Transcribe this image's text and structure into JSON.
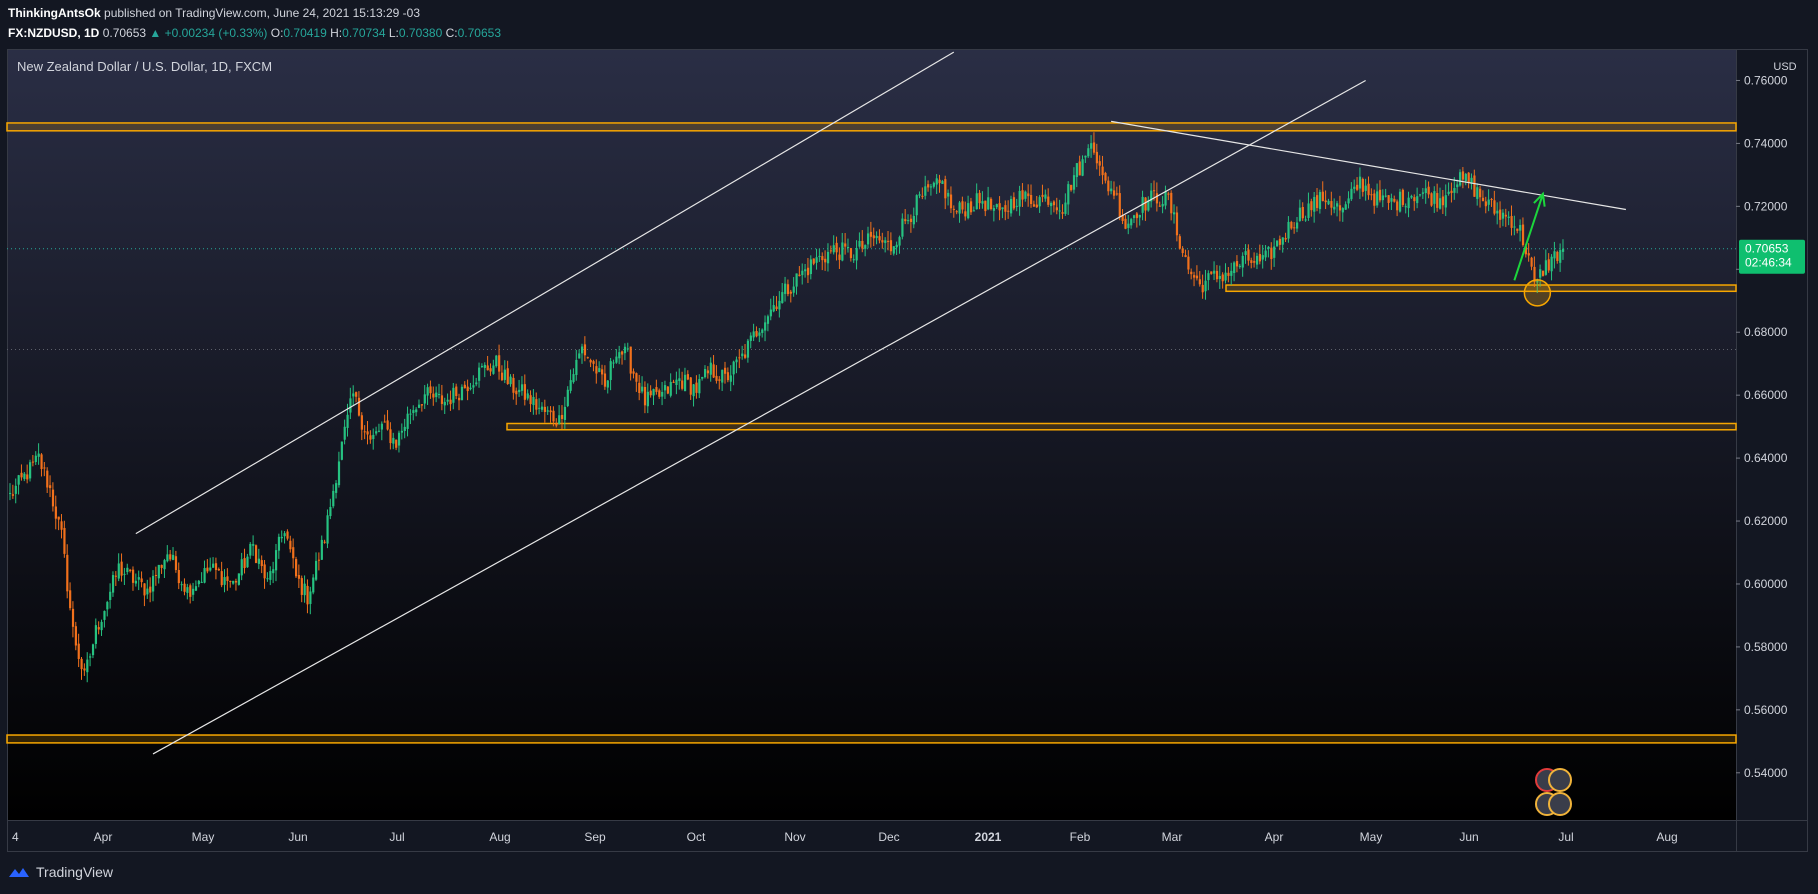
{
  "header": {
    "author": "ThinkingAntsOk",
    "published_text": "published on TradingView.com, June 24, 2021 15:13:29 -03",
    "symbol": "FX:NZDUSD, 1D",
    "last": "0.70653",
    "change": "▲ +0.00234 (+0.33%)",
    "o_label": "O:",
    "o": "0.70419",
    "h_label": "H:",
    "h": "0.70734",
    "l_label": "L:",
    "l": "0.70380",
    "c_label": "C:",
    "c": "0.70653"
  },
  "footer": {
    "brand": "TradingView"
  },
  "colors": {
    "up": "#26c281",
    "down": "#f2711c",
    "zone": "#f7a600",
    "trendline": "#e6e6e6",
    "arrow": "#1cd63c",
    "price_tag": "#0fbf6f"
  },
  "chart_data": {
    "type": "candlestick",
    "title": "New Zealand Dollar / U.S. Dollar, 1D, FXCM",
    "currency": "USD",
    "ylim": [
      0.525,
      0.77
    ],
    "y_ticks": [
      "0.76000",
      "0.74000",
      "0.72000",
      "0.70000",
      "0.68000",
      "0.66000",
      "0.64000",
      "0.62000",
      "0.60000",
      "0.58000",
      "0.56000",
      "0.54000"
    ],
    "x_ticks": [
      "4",
      "Apr",
      "May",
      "Jun",
      "Jul",
      "Aug",
      "Sep",
      "Oct",
      "Nov",
      "Dec",
      "2021",
      "Feb",
      "Mar",
      "Apr",
      "May",
      "Jun",
      "Jul",
      "Aug"
    ],
    "last_price": "0.70653",
    "countdown": "02:46:34",
    "dotted_price_levels": [
      0.70653,
      0.6745
    ],
    "path": [
      [
        0,
        0.628
      ],
      [
        5,
        0.634
      ],
      [
        10,
        0.64
      ],
      [
        14,
        0.63
      ],
      [
        18,
        0.615
      ],
      [
        22,
        0.585
      ],
      [
        26,
        0.57
      ],
      [
        30,
        0.585
      ],
      [
        38,
        0.605
      ],
      [
        48,
        0.598
      ],
      [
        55,
        0.61
      ],
      [
        62,
        0.598
      ],
      [
        70,
        0.605
      ],
      [
        78,
        0.6
      ],
      [
        85,
        0.612
      ],
      [
        90,
        0.6
      ],
      [
        96,
        0.618
      ],
      [
        100,
        0.602
      ],
      [
        104,
        0.596
      ],
      [
        110,
        0.615
      ],
      [
        115,
        0.64
      ],
      [
        120,
        0.66
      ],
      [
        123,
        0.652
      ],
      [
        126,
        0.645
      ],
      [
        130,
        0.65
      ],
      [
        135,
        0.645
      ],
      [
        140,
        0.655
      ],
      [
        145,
        0.66
      ],
      [
        152,
        0.658
      ],
      [
        158,
        0.662
      ],
      [
        165,
        0.668
      ],
      [
        170,
        0.67
      ],
      [
        175,
        0.663
      ],
      [
        180,
        0.66
      ],
      [
        186,
        0.655
      ],
      [
        192,
        0.652
      ],
      [
        196,
        0.665
      ],
      [
        200,
        0.675
      ],
      [
        205,
        0.668
      ],
      [
        208,
        0.662
      ],
      [
        212,
        0.675
      ],
      [
        216,
        0.672
      ],
      [
        222,
        0.658
      ],
      [
        228,
        0.66
      ],
      [
        234,
        0.665
      ],
      [
        240,
        0.662
      ],
      [
        245,
        0.668
      ],
      [
        250,
        0.665
      ],
      [
        256,
        0.672
      ],
      [
        262,
        0.682
      ],
      [
        268,
        0.69
      ],
      [
        275,
        0.697
      ],
      [
        282,
        0.703
      ],
      [
        288,
        0.706
      ],
      [
        295,
        0.705
      ],
      [
        302,
        0.71
      ],
      [
        308,
        0.707
      ],
      [
        312,
        0.714
      ],
      [
        318,
        0.722
      ],
      [
        322,
        0.725
      ],
      [
        326,
        0.727
      ],
      [
        330,
        0.718
      ],
      [
        335,
        0.72
      ],
      [
        340,
        0.722
      ],
      [
        346,
        0.717
      ],
      [
        352,
        0.723
      ],
      [
        358,
        0.722
      ],
      [
        363,
        0.723
      ],
      [
        368,
        0.72
      ],
      [
        372,
        0.73
      ],
      [
        376,
        0.735
      ],
      [
        378,
        0.743
      ],
      [
        382,
        0.728
      ],
      [
        386,
        0.725
      ],
      [
        390,
        0.714
      ],
      [
        395,
        0.72
      ],
      [
        400,
        0.723
      ],
      [
        405,
        0.722
      ],
      [
        408,
        0.712
      ],
      [
        412,
        0.7
      ],
      [
        416,
        0.695
      ],
      [
        420,
        0.697
      ],
      [
        426,
        0.699
      ],
      [
        432,
        0.703
      ],
      [
        438,
        0.702
      ],
      [
        444,
        0.709
      ],
      [
        450,
        0.717
      ],
      [
        455,
        0.72
      ],
      [
        460,
        0.723
      ],
      [
        466,
        0.718
      ],
      [
        472,
        0.728
      ],
      [
        478,
        0.722
      ],
      [
        484,
        0.721
      ],
      [
        490,
        0.724
      ],
      [
        495,
        0.724
      ],
      [
        500,
        0.722
      ],
      [
        505,
        0.728
      ],
      [
        510,
        0.728
      ],
      [
        515,
        0.722
      ],
      [
        520,
        0.718
      ],
      [
        525,
        0.716
      ],
      [
        528,
        0.712
      ],
      [
        531,
        0.704
      ],
      [
        533,
        0.694
      ],
      [
        536,
        0.7
      ],
      [
        540,
        0.704
      ],
      [
        543,
        0.70653
      ]
    ],
    "annotations": {
      "resistance_zone": [
        0.744,
        0.7465
      ],
      "support_zone_1": [
        0.693,
        0.695
      ],
      "support_zone_2": [
        0.649,
        0.651
      ],
      "support_zone_3": [
        0.5495,
        0.552
      ],
      "channel_upper": [
        [
          44,
          0.616
        ],
        [
          330,
          0.769
        ]
      ],
      "channel_lower": [
        [
          50,
          0.546
        ],
        [
          474,
          0.76
        ]
      ],
      "descending_resistance": [
        [
          385,
          0.747
        ],
        [
          565,
          0.719
        ]
      ],
      "projection_arrow": [
        [
          526,
          0.6965
        ],
        [
          536,
          0.724
        ]
      ]
    }
  }
}
